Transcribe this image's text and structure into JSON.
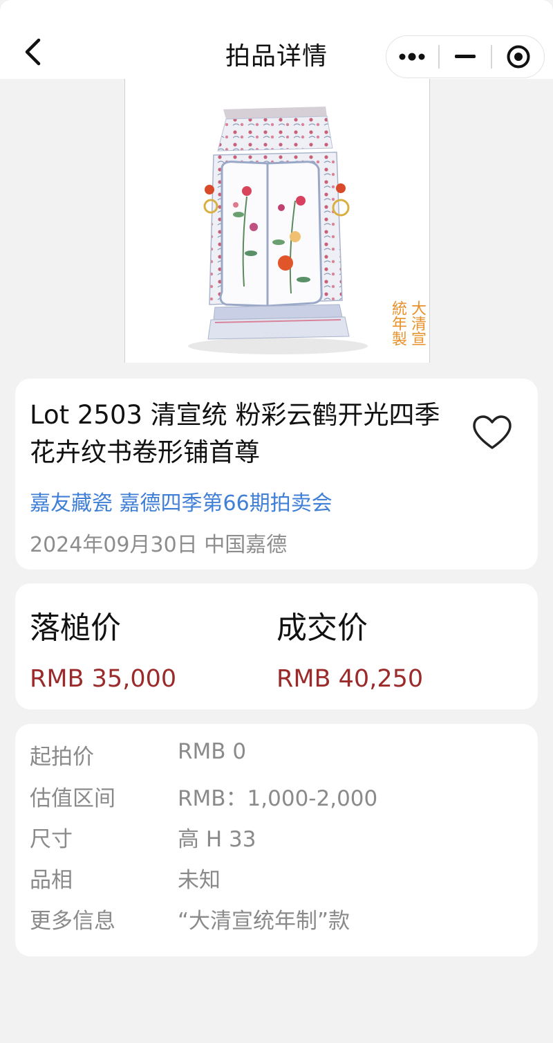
{
  "nav": {
    "title": "拍品详情"
  },
  "lot": {
    "title": "Lot 2503 清宣统 粉彩云鹤开光四季花卉纹书卷形铺首尊",
    "auction": "嘉友藏瓷 嘉德四季第66期拍卖会",
    "date_place": "2024年09月30日 中国嘉德",
    "seal_text": "大清宣統年製"
  },
  "prices": {
    "hammer_label": "落槌价",
    "hammer_value": "RMB 35,000",
    "deal_label": "成交价",
    "deal_value": "RMB 40,250"
  },
  "info": [
    {
      "label": "起拍价",
      "value": "RMB 0"
    },
    {
      "label": "估值区间",
      "value": "RMB：1,000-2,000"
    },
    {
      "label": "尺寸",
      "value": "高 H 33"
    },
    {
      "label": "品相",
      "value": "未知"
    },
    {
      "label": "更多信息",
      "value": "“大清宣统年制”款"
    }
  ],
  "colors": {
    "accent_link": "#3f7fd6",
    "price_red": "#9b2a2a",
    "background": "#f2f2f2",
    "card": "#ffffff"
  },
  "icons": {
    "back": "chevron-left-icon",
    "more": "more-dots-icon",
    "minimize": "minus-icon",
    "close": "target-circle-icon",
    "favorite": "heart-outline-icon"
  }
}
